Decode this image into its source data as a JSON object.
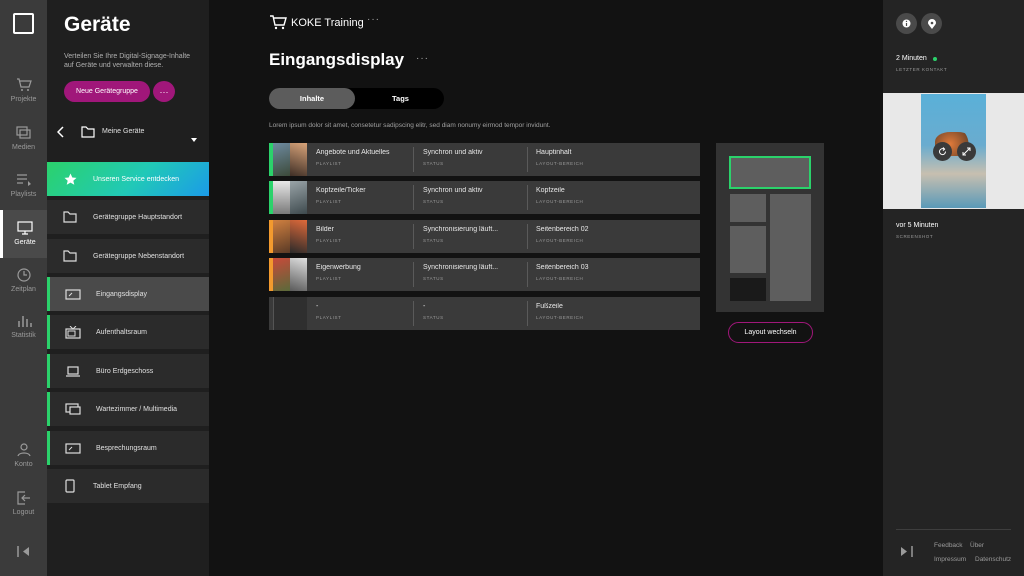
{
  "rail": {
    "items": [
      {
        "label": "Projekte",
        "icon": "cart-icon"
      },
      {
        "label": "Medien",
        "icon": "media-icon"
      },
      {
        "label": "Playlists",
        "icon": "playlist-icon"
      },
      {
        "label": "Geräte",
        "icon": "monitor-icon",
        "active": true
      },
      {
        "label": "Zeitplan",
        "icon": "clock-icon"
      },
      {
        "label": "Statistik",
        "icon": "chart-icon"
      },
      {
        "label": "Konto",
        "icon": "user-icon"
      },
      {
        "label": "Logout",
        "icon": "logout-icon"
      }
    ]
  },
  "sidebar": {
    "title": "Geräte",
    "description": "Verteilen Sie Ihre Digital-Signage-Inhalte auf Geräte und verwalten diese.",
    "new_group_label": "Neue Gerätegruppe",
    "more_label": "···",
    "folder_label": "Meine Geräte",
    "promo_label": "Unseren Service entdecken",
    "items": [
      {
        "label": "Gerätegruppe Hauptstandort",
        "icon": "folder-icon"
      },
      {
        "label": "Gerätegruppe Nebenstandort",
        "icon": "folder-icon"
      },
      {
        "label": "Eingangsdisplay",
        "icon": "display-icon"
      },
      {
        "label": "Aufenthaltsraum",
        "icon": "tv-icon"
      },
      {
        "label": "Büro Erdgeschoss",
        "icon": "laptop-icon"
      },
      {
        "label": "Wartezimmer / Multimedia",
        "icon": "monitor-icon"
      },
      {
        "label": "Besprechungsraum",
        "icon": "display-icon"
      },
      {
        "label": "Tablet Empfang",
        "icon": "tablet-icon"
      }
    ]
  },
  "header": {
    "project": "KOKE Training",
    "more": "···"
  },
  "main": {
    "title": "Eingangsdisplay",
    "title_more": "···",
    "tabs": [
      {
        "label": "Inhalte",
        "active": true
      },
      {
        "label": "Tags"
      }
    ],
    "description": "Lorem ipsum dolor sit amet, consetetur sadipscing elitr, sed diam nonumy eirmod tempor invidunt.",
    "column_sub": {
      "playlist": "PLAYLIST",
      "status": "STATUS",
      "layout": "LAYOUT-BEREICH"
    },
    "rows": [
      {
        "playlist": "Angebote und Aktuelles",
        "status": "Synchron und aktiv",
        "layout": "Hauptinhalt",
        "accent": "#2bd26b"
      },
      {
        "playlist": "Kopfzeile/Ticker",
        "status": "Synchron und aktiv",
        "layout": "Kopfzeile",
        "accent": "#2bd26b"
      },
      {
        "playlist": "Bilder",
        "status": "Synchronisierung läuft...",
        "layout": "Seitenbereich 02",
        "accent": "#f39a2e"
      },
      {
        "playlist": "Eigenwerbung",
        "status": "Synchronisierung läuft...",
        "layout": "Seitenbereich 03",
        "accent": "#f39a2e"
      },
      {
        "playlist": "-",
        "status": "-",
        "layout": "Fußzeile",
        "accent": "#3a3a3a"
      }
    ],
    "layout_button": "Layout wechseln"
  },
  "right": {
    "contact_value": "2 Minuten",
    "contact_label": "LETZTER KONTAKT",
    "screenshot_value": "vor 5 Minuten",
    "screenshot_label": "SCREENSHOT",
    "footer_links": [
      "Feedback",
      "Über",
      "Impressum",
      "Datenschutz"
    ]
  },
  "colors": {
    "accent_green": "#2bd26b",
    "accent_orange": "#f39a2e",
    "brand_magenta": "#a0177a"
  }
}
